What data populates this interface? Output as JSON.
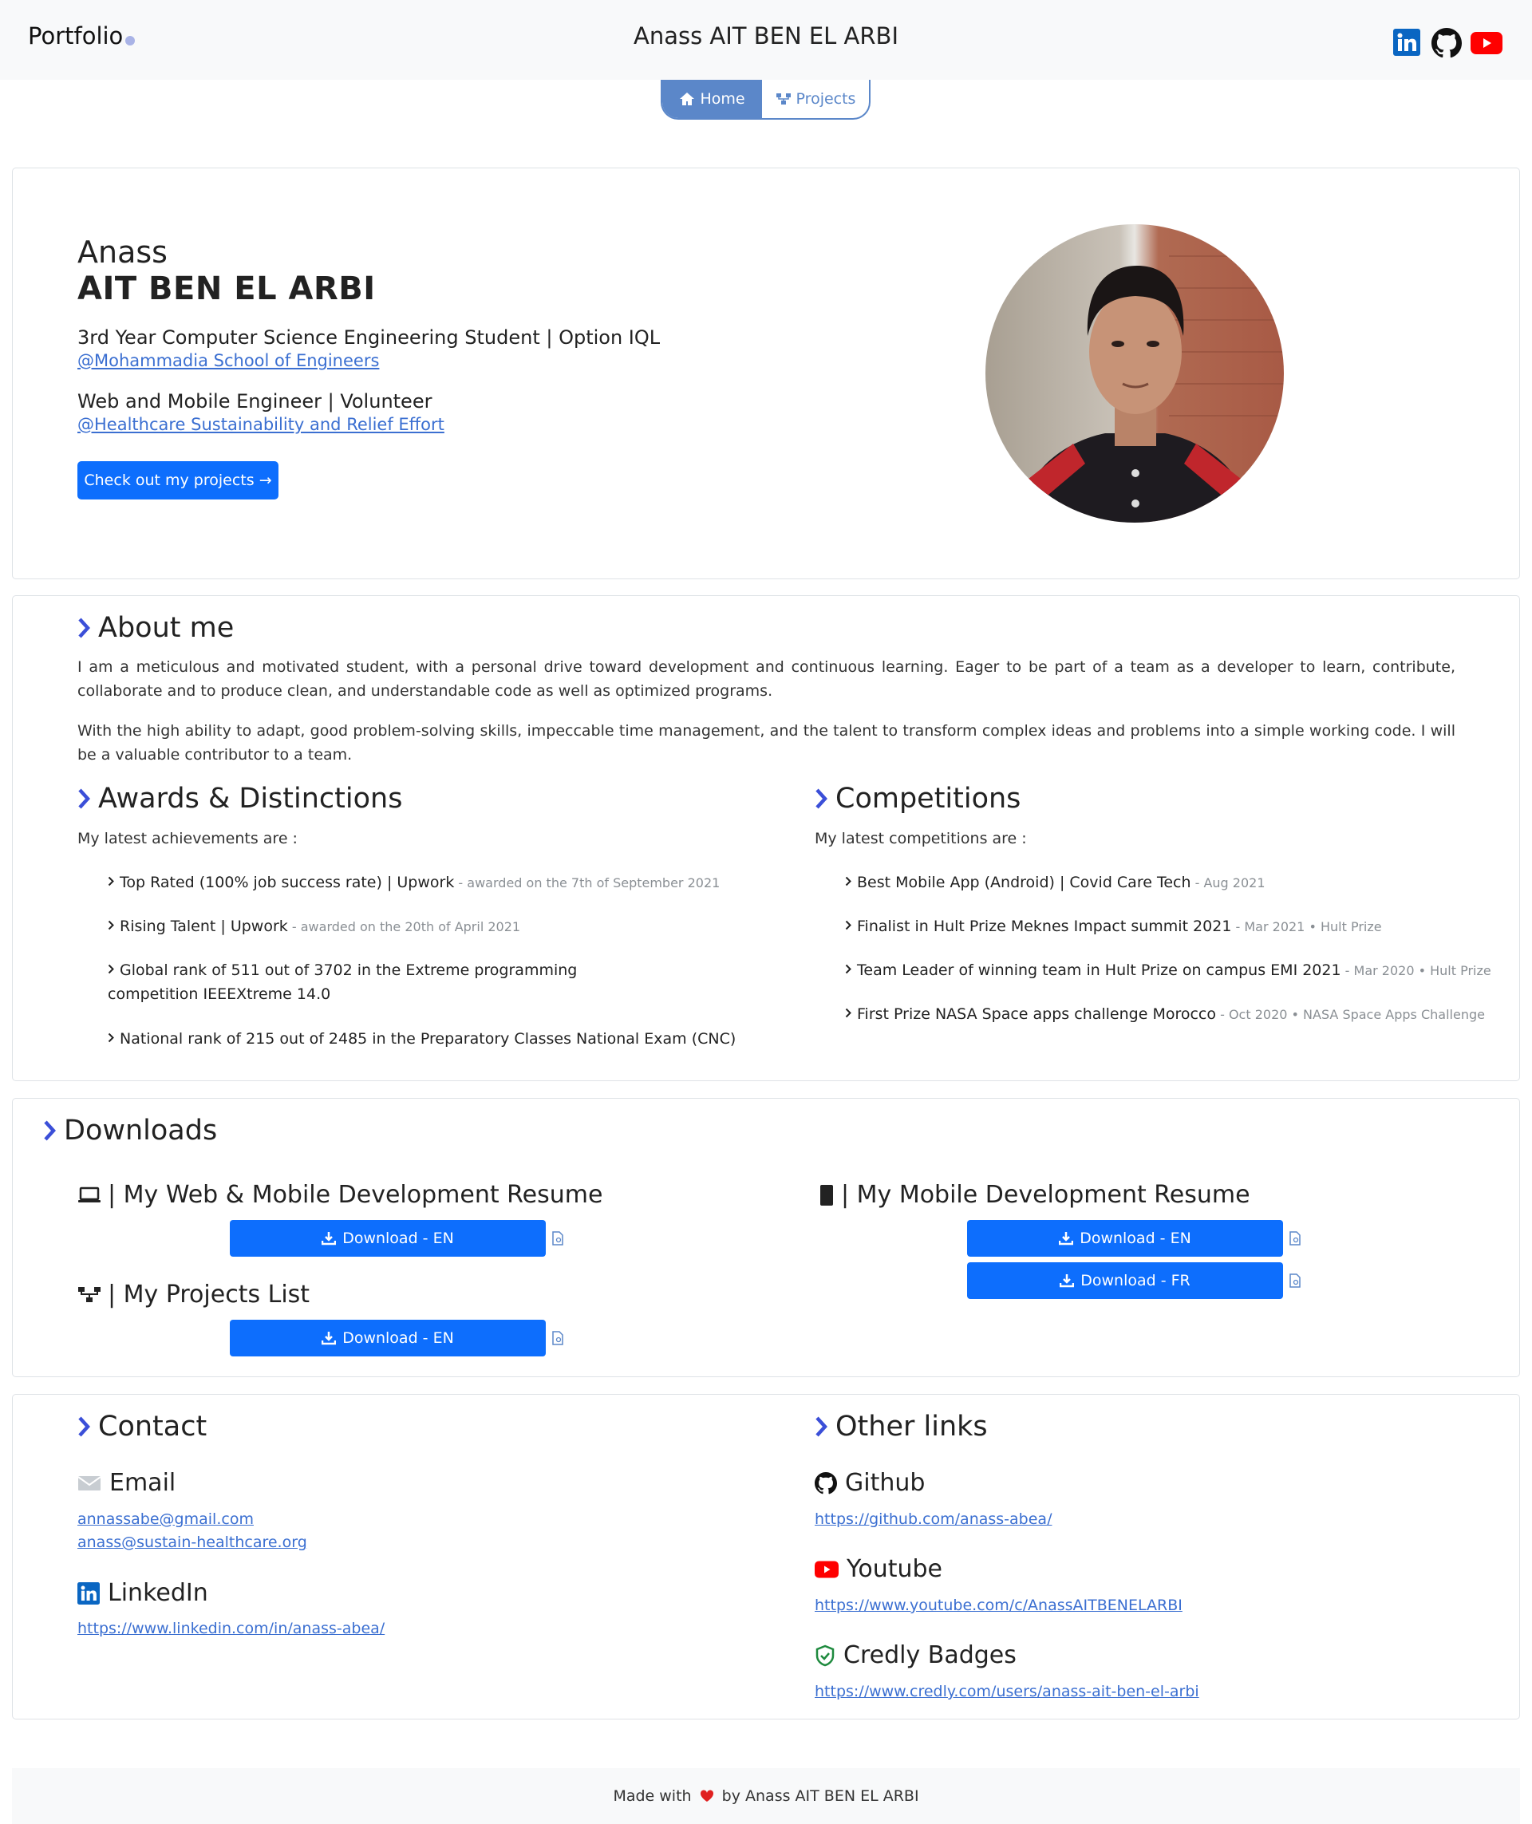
{
  "header": {
    "brand": "Portfolio",
    "title": "Anass AIT BEN EL ARBI",
    "social_icons": [
      "linkedin-icon",
      "github-icon",
      "youtube-icon"
    ]
  },
  "nav": {
    "home": "Home",
    "projects": "Projects"
  },
  "hero": {
    "first_name": "Anass",
    "last_name": "AIT BEN EL ARBI",
    "role1": "3rd Year Computer Science Engineering Student | Option IQL",
    "org1": "@Mohammadia School of Engineers",
    "role2": "Web and Mobile Engineer | Volunteer",
    "org2": "@Healthcare Sustainability and Relief Effort",
    "cta": "Check out my projects →"
  },
  "about": {
    "title": "About me",
    "p1": "I am a meticulous and motivated student, with a personal drive toward development and continuous learning. Eager to be part of a team as a developer to learn, contribute, collaborate and to produce clean, and understandable code as well as optimized programs.",
    "p2": "With the high ability to adapt, good problem-solving skills, impeccable time management, and the talent to transform complex ideas and problems into a simple working code. I will be a valuable contributor to a team."
  },
  "awards": {
    "title": "Awards & Distinctions",
    "intro": "My latest achievements are :",
    "items": [
      {
        "text": "Top Rated (100% job success rate) | Upwork",
        "meta": " - awarded on the 7th of September 2021"
      },
      {
        "text": "Rising Talent | Upwork",
        "meta": " - awarded on the 20th of April 2021"
      },
      {
        "text": "Global rank of 511 out of 3702 in the Extreme programming competition IEEEXtreme 14.0",
        "meta": ""
      },
      {
        "text": "National rank of 215 out of 2485 in the Preparatory Classes National Exam (CNC)",
        "meta": ""
      }
    ]
  },
  "competitions": {
    "title": "Competitions",
    "intro": "My latest competitions are :",
    "items": [
      {
        "text": "Best Mobile App (Android) | Covid Care Tech",
        "meta": " - Aug 2021"
      },
      {
        "text": "Finalist in Hult Prize Meknes Impact summit 2021",
        "meta": " - Mar 2021 • Hult Prize"
      },
      {
        "text": "Team Leader of winning team in Hult Prize on campus EMI 2021",
        "meta": " - Mar 2020 • Hult Prize"
      },
      {
        "text": "First Prize NASA Space apps challenge Morocco",
        "meta": " - Oct 2020 • NASA Space Apps Challenge"
      }
    ]
  },
  "downloads": {
    "title": "Downloads",
    "web_resume": "| My Web & Mobile Development Resume",
    "mobile_resume": "| My Mobile Development Resume",
    "projects_list": "| My Projects List",
    "btn_en": "Download - EN",
    "btn_fr": "Download - FR"
  },
  "contact": {
    "title": "Contact",
    "email_label": "Email",
    "email1": "annassabe@gmail.com",
    "email2": "anass@sustain-healthcare.org",
    "linkedin_label": "LinkedIn",
    "linkedin_url": "https://www.linkedin.com/in/anass-abea/"
  },
  "other": {
    "title": "Other links",
    "github_label": "Github",
    "github_url": "https://github.com/anass-abea/",
    "youtube_label": "Youtube",
    "youtube_url": "https://www.youtube.com/c/AnassAITBENELARBI",
    "credly_label": "Credly Badges",
    "credly_url": "https://www.credly.com/users/anass-ait-ben-el-arbi"
  },
  "footer": {
    "before": "Made with",
    "after": "by Anass AIT BEN EL ARBI"
  },
  "colors": {
    "primary": "#0d6efd",
    "nav": "#5b87c9",
    "chevron": "#3b4fd8",
    "heart": "#e02020"
  }
}
